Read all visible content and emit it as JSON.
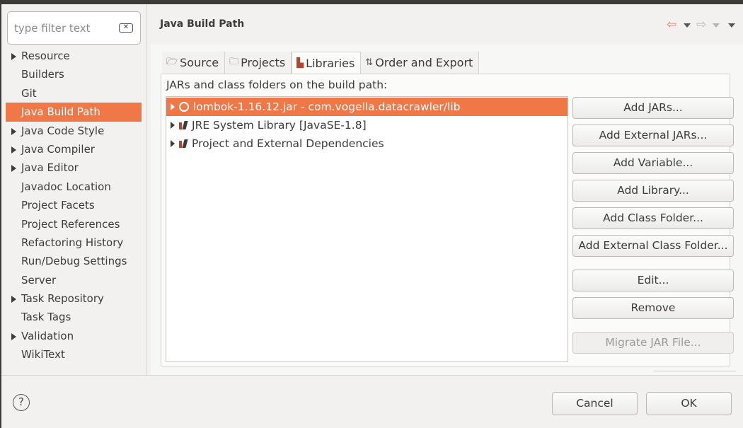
{
  "sidebar": {
    "filter_placeholder": "type filter text",
    "items": [
      {
        "label": "Resource",
        "expandable": true
      },
      {
        "label": "Builders",
        "expandable": false
      },
      {
        "label": "Git",
        "expandable": false
      },
      {
        "label": "Java Build Path",
        "expandable": false,
        "selected": true
      },
      {
        "label": "Java Code Style",
        "expandable": true
      },
      {
        "label": "Java Compiler",
        "expandable": true
      },
      {
        "label": "Java Editor",
        "expandable": true
      },
      {
        "label": "Javadoc Location",
        "expandable": false
      },
      {
        "label": "Project Facets",
        "expandable": false
      },
      {
        "label": "Project References",
        "expandable": false
      },
      {
        "label": "Refactoring History",
        "expandable": false
      },
      {
        "label": "Run/Debug Settings",
        "expandable": false
      },
      {
        "label": "Server",
        "expandable": false
      },
      {
        "label": "Task Repository",
        "expandable": true
      },
      {
        "label": "Task Tags",
        "expandable": false
      },
      {
        "label": "Validation",
        "expandable": true
      },
      {
        "label": "WikiText",
        "expandable": false
      }
    ]
  },
  "page": {
    "title": "Java Build Path"
  },
  "tabs": [
    {
      "label": "Source",
      "icon": "source-folder-icon"
    },
    {
      "label": "Projects",
      "icon": "projects-folder-icon"
    },
    {
      "label": "Libraries",
      "icon": "library-icon",
      "active": true
    },
    {
      "label": "Order and Export",
      "icon": "order-export-icon"
    }
  ],
  "libraries": {
    "section_label": "JARs and class folders on the build path:",
    "entries": [
      {
        "label": "lombok-1.16.12.jar - com.vogella.datacrawler/lib",
        "icon": "jar-icon",
        "selected": true
      },
      {
        "label": "JRE System Library [JavaSE-1.8]",
        "icon": "library-icon"
      },
      {
        "label": "Project and External Dependencies",
        "icon": "library-icon"
      }
    ]
  },
  "buttons": {
    "add_jars": "Add JARs...",
    "add_external_jars": "Add External JARs...",
    "add_variable": "Add Variable...",
    "add_library": "Add Library...",
    "add_class_folder": "Add Class Folder...",
    "add_external_class_folder": "Add External Class Folder...",
    "edit": "Edit...",
    "remove": "Remove",
    "migrate_jar": "Migrate JAR File..."
  },
  "dialog": {
    "cancel": "Cancel",
    "ok": "OK",
    "help_icon": "help-icon"
  },
  "colors": {
    "selection": "#f07746",
    "background": "#f2f1f0"
  }
}
